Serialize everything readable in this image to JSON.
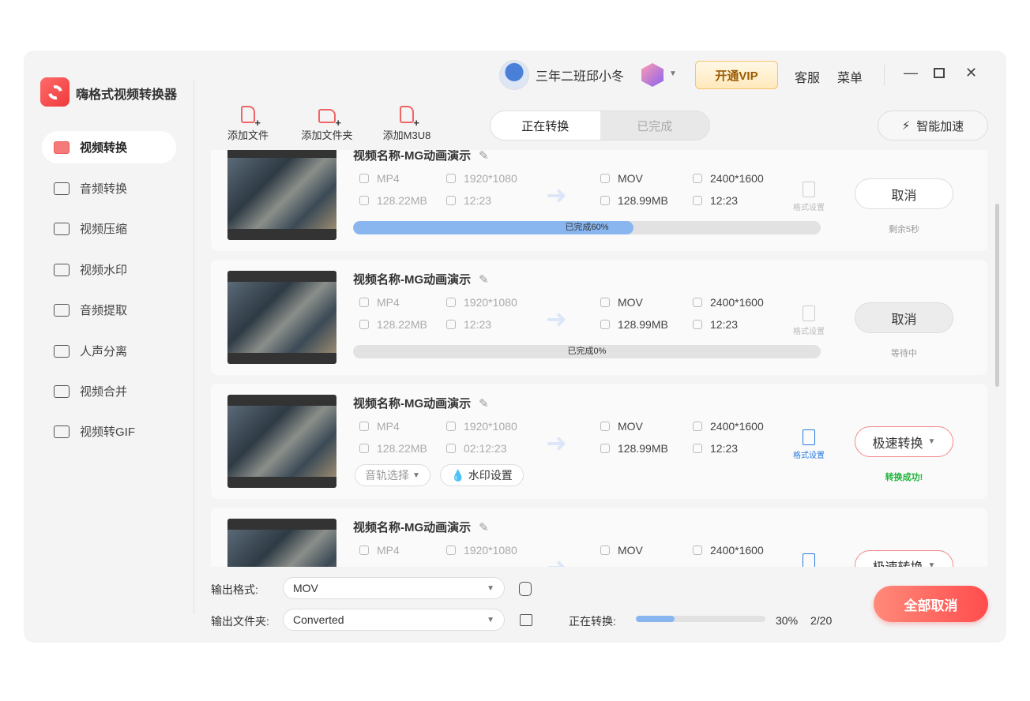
{
  "app": {
    "title": "嗨格式视频转换器",
    "brand_color": "#f15a5a"
  },
  "header": {
    "username": "三年二班邱小冬",
    "vip_label": "开通VIP",
    "service": "客服",
    "menu": "菜单"
  },
  "sidebar": {
    "items": [
      {
        "label": "视频转换",
        "icon": "video-convert-icon",
        "active": true
      },
      {
        "label": "音频转换",
        "icon": "audio-convert-icon"
      },
      {
        "label": "视频压缩",
        "icon": "video-compress-icon"
      },
      {
        "label": "视频水印",
        "icon": "video-watermark-icon"
      },
      {
        "label": "音频提取",
        "icon": "audio-extract-icon"
      },
      {
        "label": "人声分离",
        "icon": "voice-separate-icon"
      },
      {
        "label": "视频合并",
        "icon": "video-merge-icon"
      },
      {
        "label": "视频转GIF",
        "icon": "gif-icon"
      }
    ]
  },
  "toolbar": {
    "add_file": "添加文件",
    "add_folder": "添加文件夹",
    "add_m3u8": "添加M3U8",
    "accelerate": "智能加速"
  },
  "tabs": [
    {
      "label": "正在转换",
      "active": true
    },
    {
      "label": "已完成"
    }
  ],
  "tasks": [
    {
      "name": "视频名称-MG动画演示",
      "src_format": "MP4",
      "src_res": "1920*1080",
      "src_size": "128.22MB",
      "src_dur": "12:23",
      "dst_format": "MOV",
      "dst_res": "2400*1600",
      "dst_size": "128.99MB",
      "dst_dur": "12:23",
      "format_settings": "格式设置",
      "button": "取消",
      "status": "剩余5秒",
      "progress_label": "已完成60%",
      "progress": 60
    },
    {
      "name": "视频名称-MG动画演示",
      "src_format": "MP4",
      "src_res": "1920*1080",
      "src_size": "128.22MB",
      "src_dur": "12:23",
      "dst_format": "MOV",
      "dst_res": "2400*1600",
      "dst_size": "128.99MB",
      "dst_dur": "12:23",
      "format_settings": "格式设置",
      "button": "取消",
      "status": "等待中",
      "progress_label": "已完成0%",
      "progress": 0
    },
    {
      "name": "视频名称-MG动画演示",
      "src_format": "MP4",
      "src_res": "1920*1080",
      "src_size": "128.22MB",
      "src_dur": "02:12:23",
      "dst_format": "MOV",
      "dst_res": "2400*1600",
      "dst_size": "128.99MB",
      "dst_dur": "12:23",
      "format_settings": "格式设置",
      "button": "极速转换",
      "status": "转换成功!",
      "audio_track": "音轨选择",
      "watermark": "水印设置"
    },
    {
      "name": "视频名称-MG动画演示",
      "src_format": "MP4",
      "src_res": "1920*1080",
      "dst_format": "MOV",
      "dst_res": "2400*1600",
      "button": "极速转换"
    }
  ],
  "footer": {
    "format_label": "输出格式:",
    "format_value": "MOV",
    "folder_label": "输出文件夹:",
    "folder_value": "Converted",
    "converting_label": "正在转换:",
    "percent": "30%",
    "progress": 30,
    "count": "2/20",
    "cancel_all": "全部取消"
  }
}
